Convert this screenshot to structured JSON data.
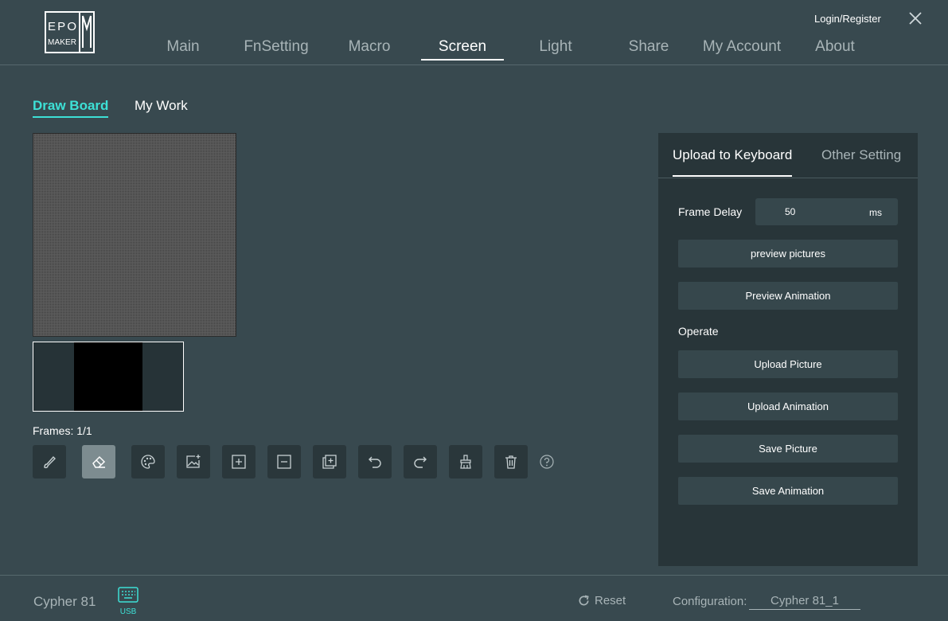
{
  "header": {
    "logo_text": "EPOMAKER",
    "login_label": "Login/Register",
    "nav": [
      {
        "label": "Main"
      },
      {
        "label": "FnSetting"
      },
      {
        "label": "Macro"
      },
      {
        "label": "Screen",
        "active": true
      },
      {
        "label": "Light"
      },
      {
        "label": "Share"
      },
      {
        "label": "My Account"
      },
      {
        "label": "About"
      }
    ]
  },
  "subtabs": {
    "draw_board": "Draw Board",
    "my_work": "My Work",
    "active": "Draw Board"
  },
  "board": {
    "frames_label": "Frames: 1/1",
    "tools": [
      {
        "icon": "brush-icon"
      },
      {
        "icon": "eraser-icon",
        "active": true
      },
      {
        "icon": "palette-icon"
      },
      {
        "icon": "image-add-icon"
      },
      {
        "icon": "add-frame-icon"
      },
      {
        "icon": "remove-frame-icon"
      },
      {
        "icon": "copy-frame-icon"
      },
      {
        "icon": "undo-icon"
      },
      {
        "icon": "redo-icon"
      },
      {
        "icon": "clear-brush-icon"
      },
      {
        "icon": "trash-icon"
      }
    ],
    "help_icon": "help-icon"
  },
  "panel": {
    "tab_upload": "Upload to Keyboard",
    "tab_other": "Other Setting",
    "frame_delay_label": "Frame Delay",
    "frame_delay_value": "50",
    "frame_delay_unit": "ms",
    "preview_pictures": "preview pictures",
    "preview_animation": "Preview Animation",
    "operate_label": "Operate",
    "upload_picture": "Upload Picture",
    "upload_animation": "Upload Animation",
    "save_picture": "Save Picture",
    "save_animation": "Save Animation"
  },
  "footer": {
    "device_name": "Cypher 81",
    "usb_label": "USB",
    "reset_label": "Reset",
    "configuration_label": "Configuration:",
    "configuration_value": "Cypher 81_1"
  },
  "colors": {
    "background": "#38494f",
    "panel": "#283539",
    "accent": "#3de0d6",
    "button": "#36474c"
  }
}
